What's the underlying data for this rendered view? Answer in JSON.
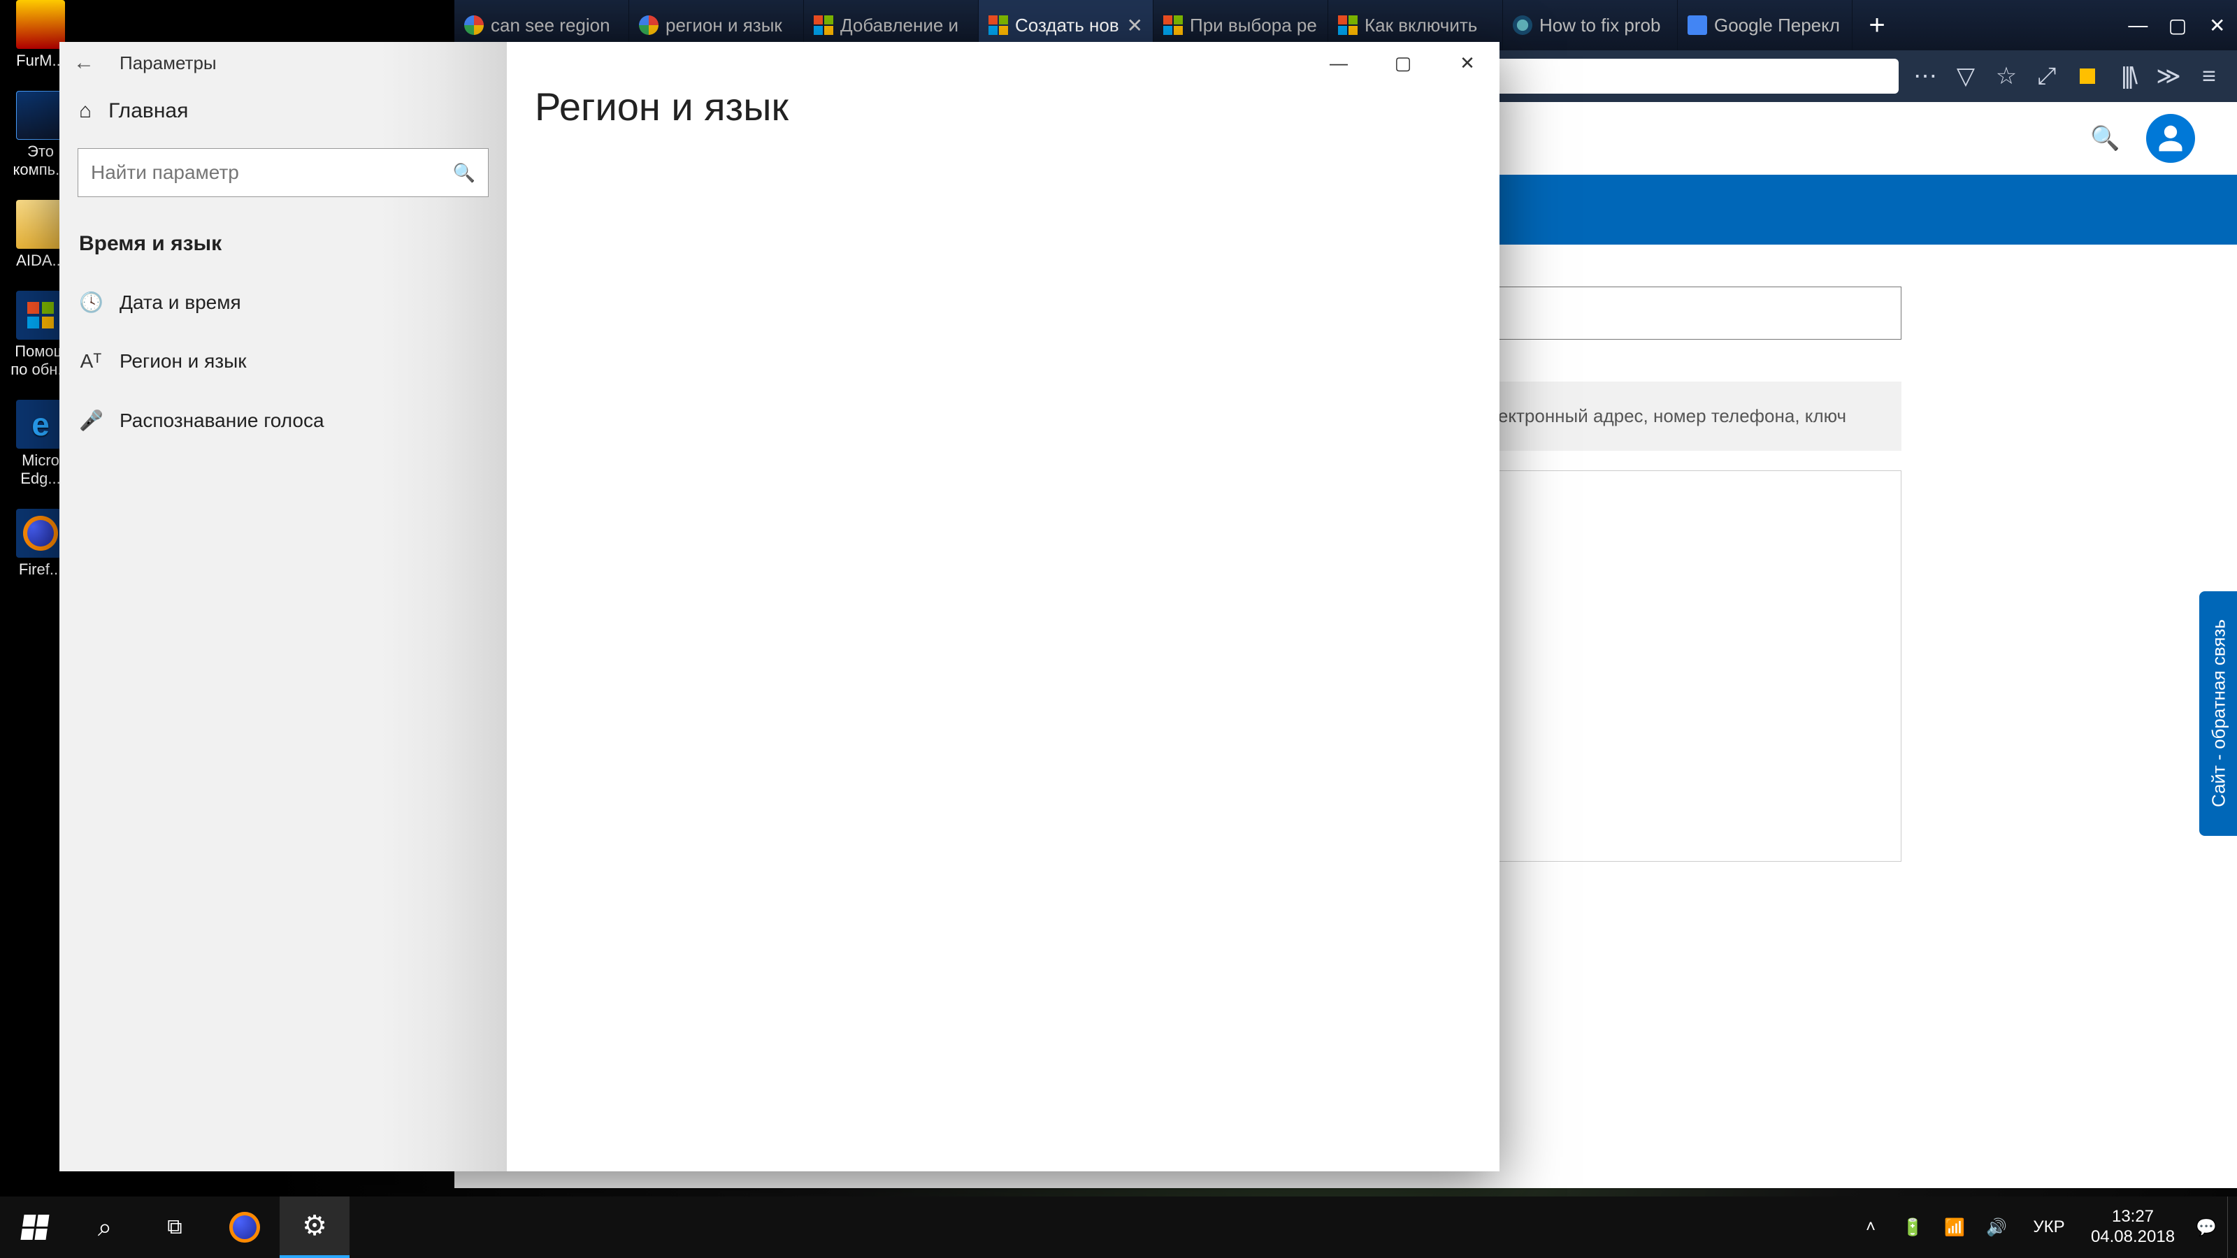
{
  "desktop": {
    "icons": [
      {
        "name": "furmark",
        "label": "FurM...",
        "picClass": "pic-furmark"
      },
      {
        "name": "this-pc",
        "label": "Это компь...",
        "picClass": "pic-pc"
      },
      {
        "name": "aida",
        "label": "AIDA...",
        "picClass": "pic-folder"
      },
      {
        "name": "helper",
        "label": "Помощ по обн...",
        "picClass": "pic-helper"
      },
      {
        "name": "edge",
        "label": "Micro Edg...",
        "picClass": "pic-edge"
      },
      {
        "name": "firefox",
        "label": "Firef...",
        "picClass": "pic-ff"
      }
    ]
  },
  "browser": {
    "tabs": [
      {
        "label": "can see region",
        "icon": "g",
        "active": false
      },
      {
        "label": "регион и язык",
        "icon": "g",
        "active": false
      },
      {
        "label": "Добавление и",
        "icon": "ms",
        "active": false
      },
      {
        "label": "Создать нов",
        "icon": "ms",
        "active": true
      },
      {
        "label": "При выбора ре",
        "icon": "ms",
        "active": false
      },
      {
        "label": "Как включить",
        "icon": "ms",
        "active": false
      },
      {
        "label": "How to fix prob",
        "icon": "gear",
        "active": false
      },
      {
        "label": "Google Перекл",
        "icon": "gt",
        "active": false
      }
    ],
    "url": "%2Fwindows%2Fforum%2Fwindows_1",
    "page": {
      "body_text": "как электронный адрес, номер телефона, ключ",
      "feedback_label": "Сайт - обратная связь"
    }
  },
  "settings": {
    "window_title": "Параметры",
    "home_label": "Главная",
    "search_placeholder": "Найти параметр",
    "category_label": "Время и язык",
    "items": [
      {
        "icon": "🕓",
        "label": "Дата и время",
        "name": "date-time"
      },
      {
        "icon": "Aᵀ",
        "label": "Регион и язык",
        "name": "region-language"
      },
      {
        "icon": "🎤",
        "label": "Распознавание голоса",
        "name": "speech"
      }
    ],
    "content_title": "Регион и язык"
  },
  "taskbar": {
    "lang": "УКР",
    "time": "13:27",
    "date": "04.08.2018"
  }
}
